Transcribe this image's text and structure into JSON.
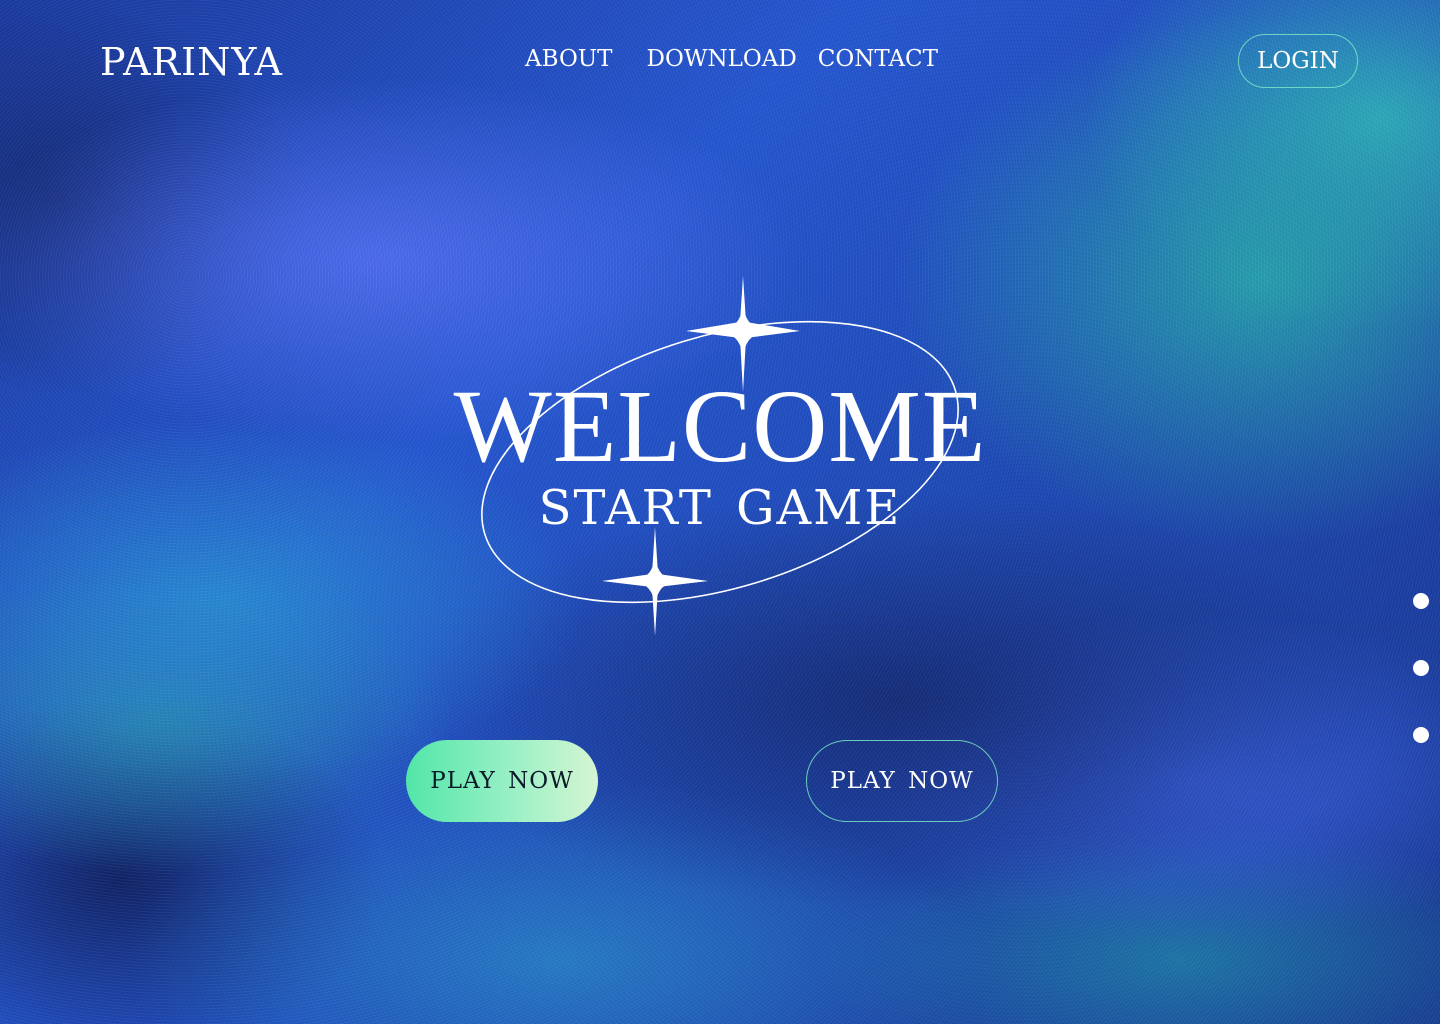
{
  "brand": {
    "logo_text": "PARINYA"
  },
  "nav": {
    "items": [
      {
        "label": "ABOUT"
      },
      {
        "label": "DOWNLOAD"
      },
      {
        "label": "CONTACT"
      }
    ],
    "login_label": "LOGIN"
  },
  "hero": {
    "title": "WELCOME",
    "subtitle": "START GAME",
    "decorations": [
      "sparkle-icon",
      "sparkle-icon",
      "orbit-ellipse"
    ]
  },
  "actions": {
    "primary_label": "PLAY NOW",
    "secondary_label": "PLAY NOW"
  },
  "pager": {
    "count": 3
  },
  "colors": {
    "background_primary": "#2556d0",
    "background_teal": "#28aaaa",
    "accent_outline": "#78e6c8",
    "button_gradient_start": "#52e6a8",
    "button_gradient_end": "#d6f5d2",
    "text": "#ffffff"
  }
}
